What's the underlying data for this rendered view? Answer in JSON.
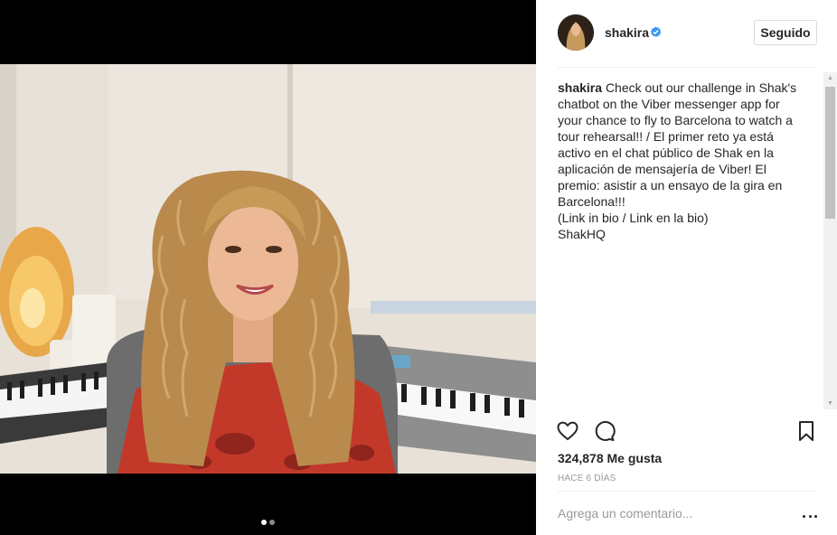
{
  "post": {
    "username": "shakira",
    "verified_icon": "verified-badge-icon",
    "follow_label": "Seguido",
    "caption": {
      "author": "shakira",
      "lines": [
        "Check out our challenge in Shak's",
        "chatbot on the Viber messenger app for",
        "your chance to fly to Barcelona to watch a",
        "tour rehearsal!! / El primer reto ya está",
        "activo en el chat público de Shak en la",
        "aplicación de mensajería de Viber! El",
        "premio: asistir a un ensayo de la gira en",
        "Barcelona!!!",
        "(Link in bio / Link en la bio)",
        "ShakHQ"
      ]
    },
    "likes": "324,878 Me gusta",
    "timestamp": "HACE 6 DÍAS",
    "comment_placeholder": "Agrega un comentario...",
    "carousel": {
      "total": 2,
      "active": 0
    },
    "icons": {
      "like": "heart-icon",
      "comment": "comment-bubble-icon",
      "save": "bookmark-icon",
      "more": "more-options-icon"
    },
    "colors": {
      "verified": "#3897f0",
      "text": "#262626",
      "muted": "#999999",
      "divider": "#efefef"
    }
  }
}
